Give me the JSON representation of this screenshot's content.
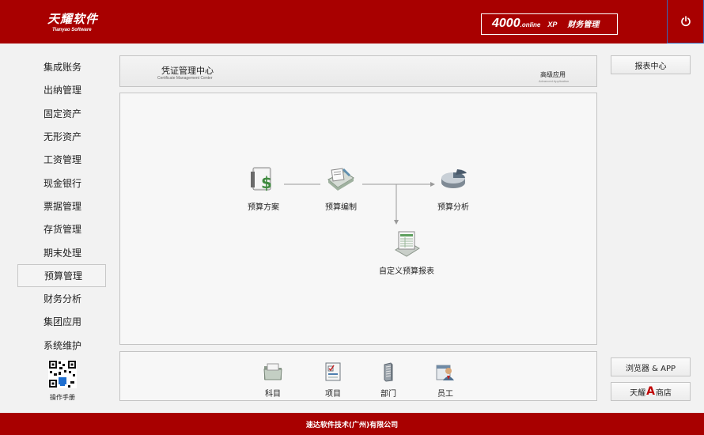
{
  "header": {
    "logo_cn": "天耀软件",
    "logo_en": "Tianyao Software",
    "product_num": "4000",
    "product_online": ".online",
    "product_xp": "XP",
    "product_name": "财务管理",
    "power_icon": "power-icon",
    "accent": "#a80000"
  },
  "sidebar": {
    "items": [
      {
        "label": "集成账务"
      },
      {
        "label": "出纳管理"
      },
      {
        "label": "固定资产"
      },
      {
        "label": "无形资产"
      },
      {
        "label": "工资管理"
      },
      {
        "label": "现金银行"
      },
      {
        "label": "票据管理"
      },
      {
        "label": "存货管理"
      },
      {
        "label": "期末处理"
      },
      {
        "label": "预算管理",
        "active": true
      },
      {
        "label": "财务分析"
      },
      {
        "label": "集团应用"
      },
      {
        "label": "系统维护"
      }
    ],
    "qr_label": "操作手册"
  },
  "module_header": {
    "title": "凭证管理中心",
    "subtitle": "Certificate Management Center",
    "advanced": "高级应用",
    "advanced_en": "Advanced Application"
  },
  "flow": {
    "nodes": [
      {
        "label": "预算方案",
        "icon": "money-document-icon"
      },
      {
        "label": "预算编制",
        "icon": "folder-edit-icon"
      },
      {
        "label": "预算分析",
        "icon": "pie-chart-icon"
      },
      {
        "label": "自定义预算报表",
        "icon": "report-table-icon"
      }
    ]
  },
  "bottom_tools": [
    {
      "label": "科目",
      "icon": "folder-icon"
    },
    {
      "label": "项目",
      "icon": "checklist-icon"
    },
    {
      "label": "部门",
      "icon": "building-icon"
    },
    {
      "label": "员工",
      "icon": "employee-icon"
    }
  ],
  "right_buttons": {
    "report_center": "报表中心",
    "browser_app": "浏览器 & APP",
    "store_prefix": "天耀",
    "store_a": "A",
    "store_suffix": "商店"
  },
  "footer": {
    "company": "速达软件技术(广州)有限公司"
  }
}
